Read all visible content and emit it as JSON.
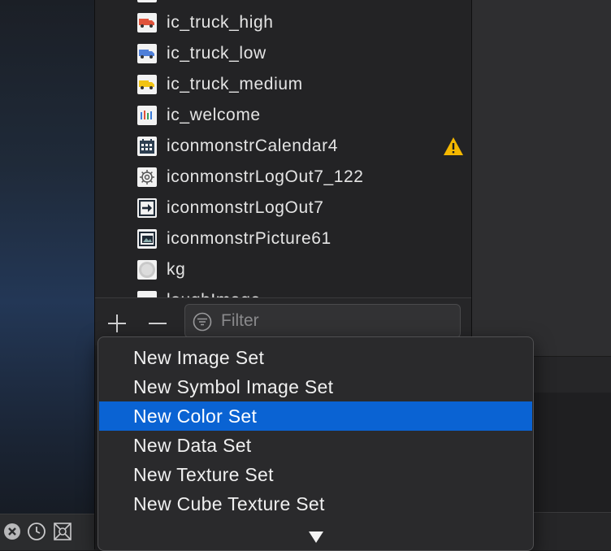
{
  "assets": [
    {
      "name": "ic_truck_high",
      "icon": "truck-red-icon",
      "warning": false
    },
    {
      "name": "ic_truck_low",
      "icon": "truck-blue-icon",
      "warning": false
    },
    {
      "name": "ic_truck_medium",
      "icon": "truck-yellow-icon",
      "warning": false
    },
    {
      "name": "ic_welcome",
      "icon": "welcome-icon",
      "warning": false
    },
    {
      "name": "iconmonstrCalendar4",
      "icon": "calendar-icon",
      "warning": true
    },
    {
      "name": "iconmonstrLogOut7_122",
      "icon": "gear-icon",
      "warning": false
    },
    {
      "name": "iconmonstrLogOut7",
      "icon": "logout-icon",
      "warning": false
    },
    {
      "name": "iconmonstrPicture61",
      "icon": "picture-icon",
      "warning": false
    },
    {
      "name": "kg",
      "icon": "kg-icon",
      "warning": false
    },
    {
      "name": "loughImage",
      "icon": "image-icon",
      "warning": false
    }
  ],
  "toolbar": {
    "add_icon": "plus-icon",
    "remove_icon": "minus-icon",
    "filter_placeholder": "Filter",
    "filter_value": ""
  },
  "menu": {
    "items": [
      {
        "label": "New Image Set",
        "selected": false
      },
      {
        "label": "New Symbol Image Set",
        "selected": false
      },
      {
        "label": "New Color Set",
        "selected": true
      },
      {
        "label": "New Data Set",
        "selected": false
      },
      {
        "label": "New Texture Set",
        "selected": false
      },
      {
        "label": "New Cube Texture Set",
        "selected": false
      }
    ],
    "scroll_indicator": "down-triangle-icon"
  },
  "colors": {
    "accent": "#0a63d3",
    "warning": "#f5b800",
    "panel": "#232325",
    "menu_bg": "#2a2a2c"
  }
}
